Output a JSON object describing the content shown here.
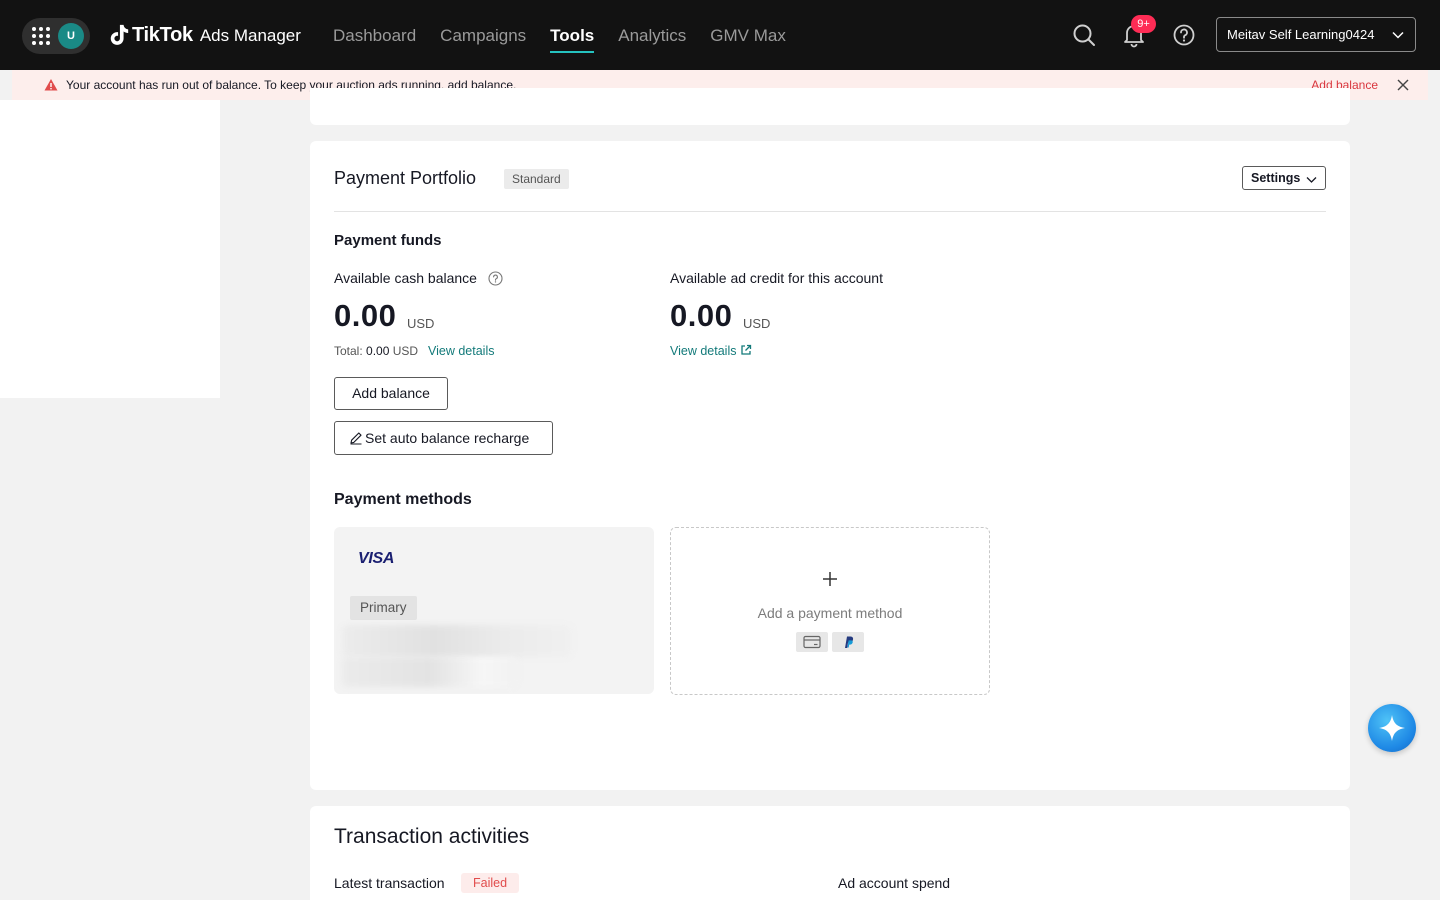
{
  "topbar": {
    "avatar_initial": "U",
    "brand": "TikTok",
    "product": "Ads Manager",
    "nav": [
      {
        "label": "Dashboard",
        "active": false
      },
      {
        "label": "Campaigns",
        "active": false
      },
      {
        "label": "Tools",
        "active": true
      },
      {
        "label": "Analytics",
        "active": false
      },
      {
        "label": "GMV Max",
        "active": false
      }
    ],
    "notifications_badge": "9+",
    "account_name": "Meitav Self Learning0424",
    "icons": [
      "apps-grid-icon",
      "search-icon",
      "bell-icon",
      "help-icon",
      "chevron-down-icon"
    ],
    "accent_color": "#25c2bf"
  },
  "alert": {
    "message": "Your account has run out of balance. To keep your auction ads running, add balance.",
    "action": "Add balance",
    "color": "#d9363e",
    "background": "#fdeeec"
  },
  "payment_portfolio": {
    "title": "Payment Portfolio",
    "tag": "Standard",
    "settings_label": "Settings",
    "funds_heading": "Payment funds",
    "cash": {
      "label": "Available cash balance",
      "amount": "0.00",
      "currency": "USD",
      "total_prefix": "Total:",
      "total_amount": "0.00",
      "total_currency": "USD",
      "link": "View details"
    },
    "credit": {
      "label": "Available ad credit for this account",
      "amount": "0.00",
      "currency": "USD",
      "link": "View details"
    },
    "add_balance_label": "Add balance",
    "auto_recharge_label": "Set auto balance recharge",
    "methods_heading": "Payment methods",
    "card": {
      "brand": "VISA",
      "tag": "Primary"
    },
    "add_method_label": "Add a payment method",
    "method_icons": [
      "credit-card-icon",
      "paypal-icon"
    ]
  },
  "transactions": {
    "title": "Transaction activities",
    "latest_label": "Latest transaction",
    "latest_status": "Failed",
    "spend_label": "Ad account spend"
  }
}
